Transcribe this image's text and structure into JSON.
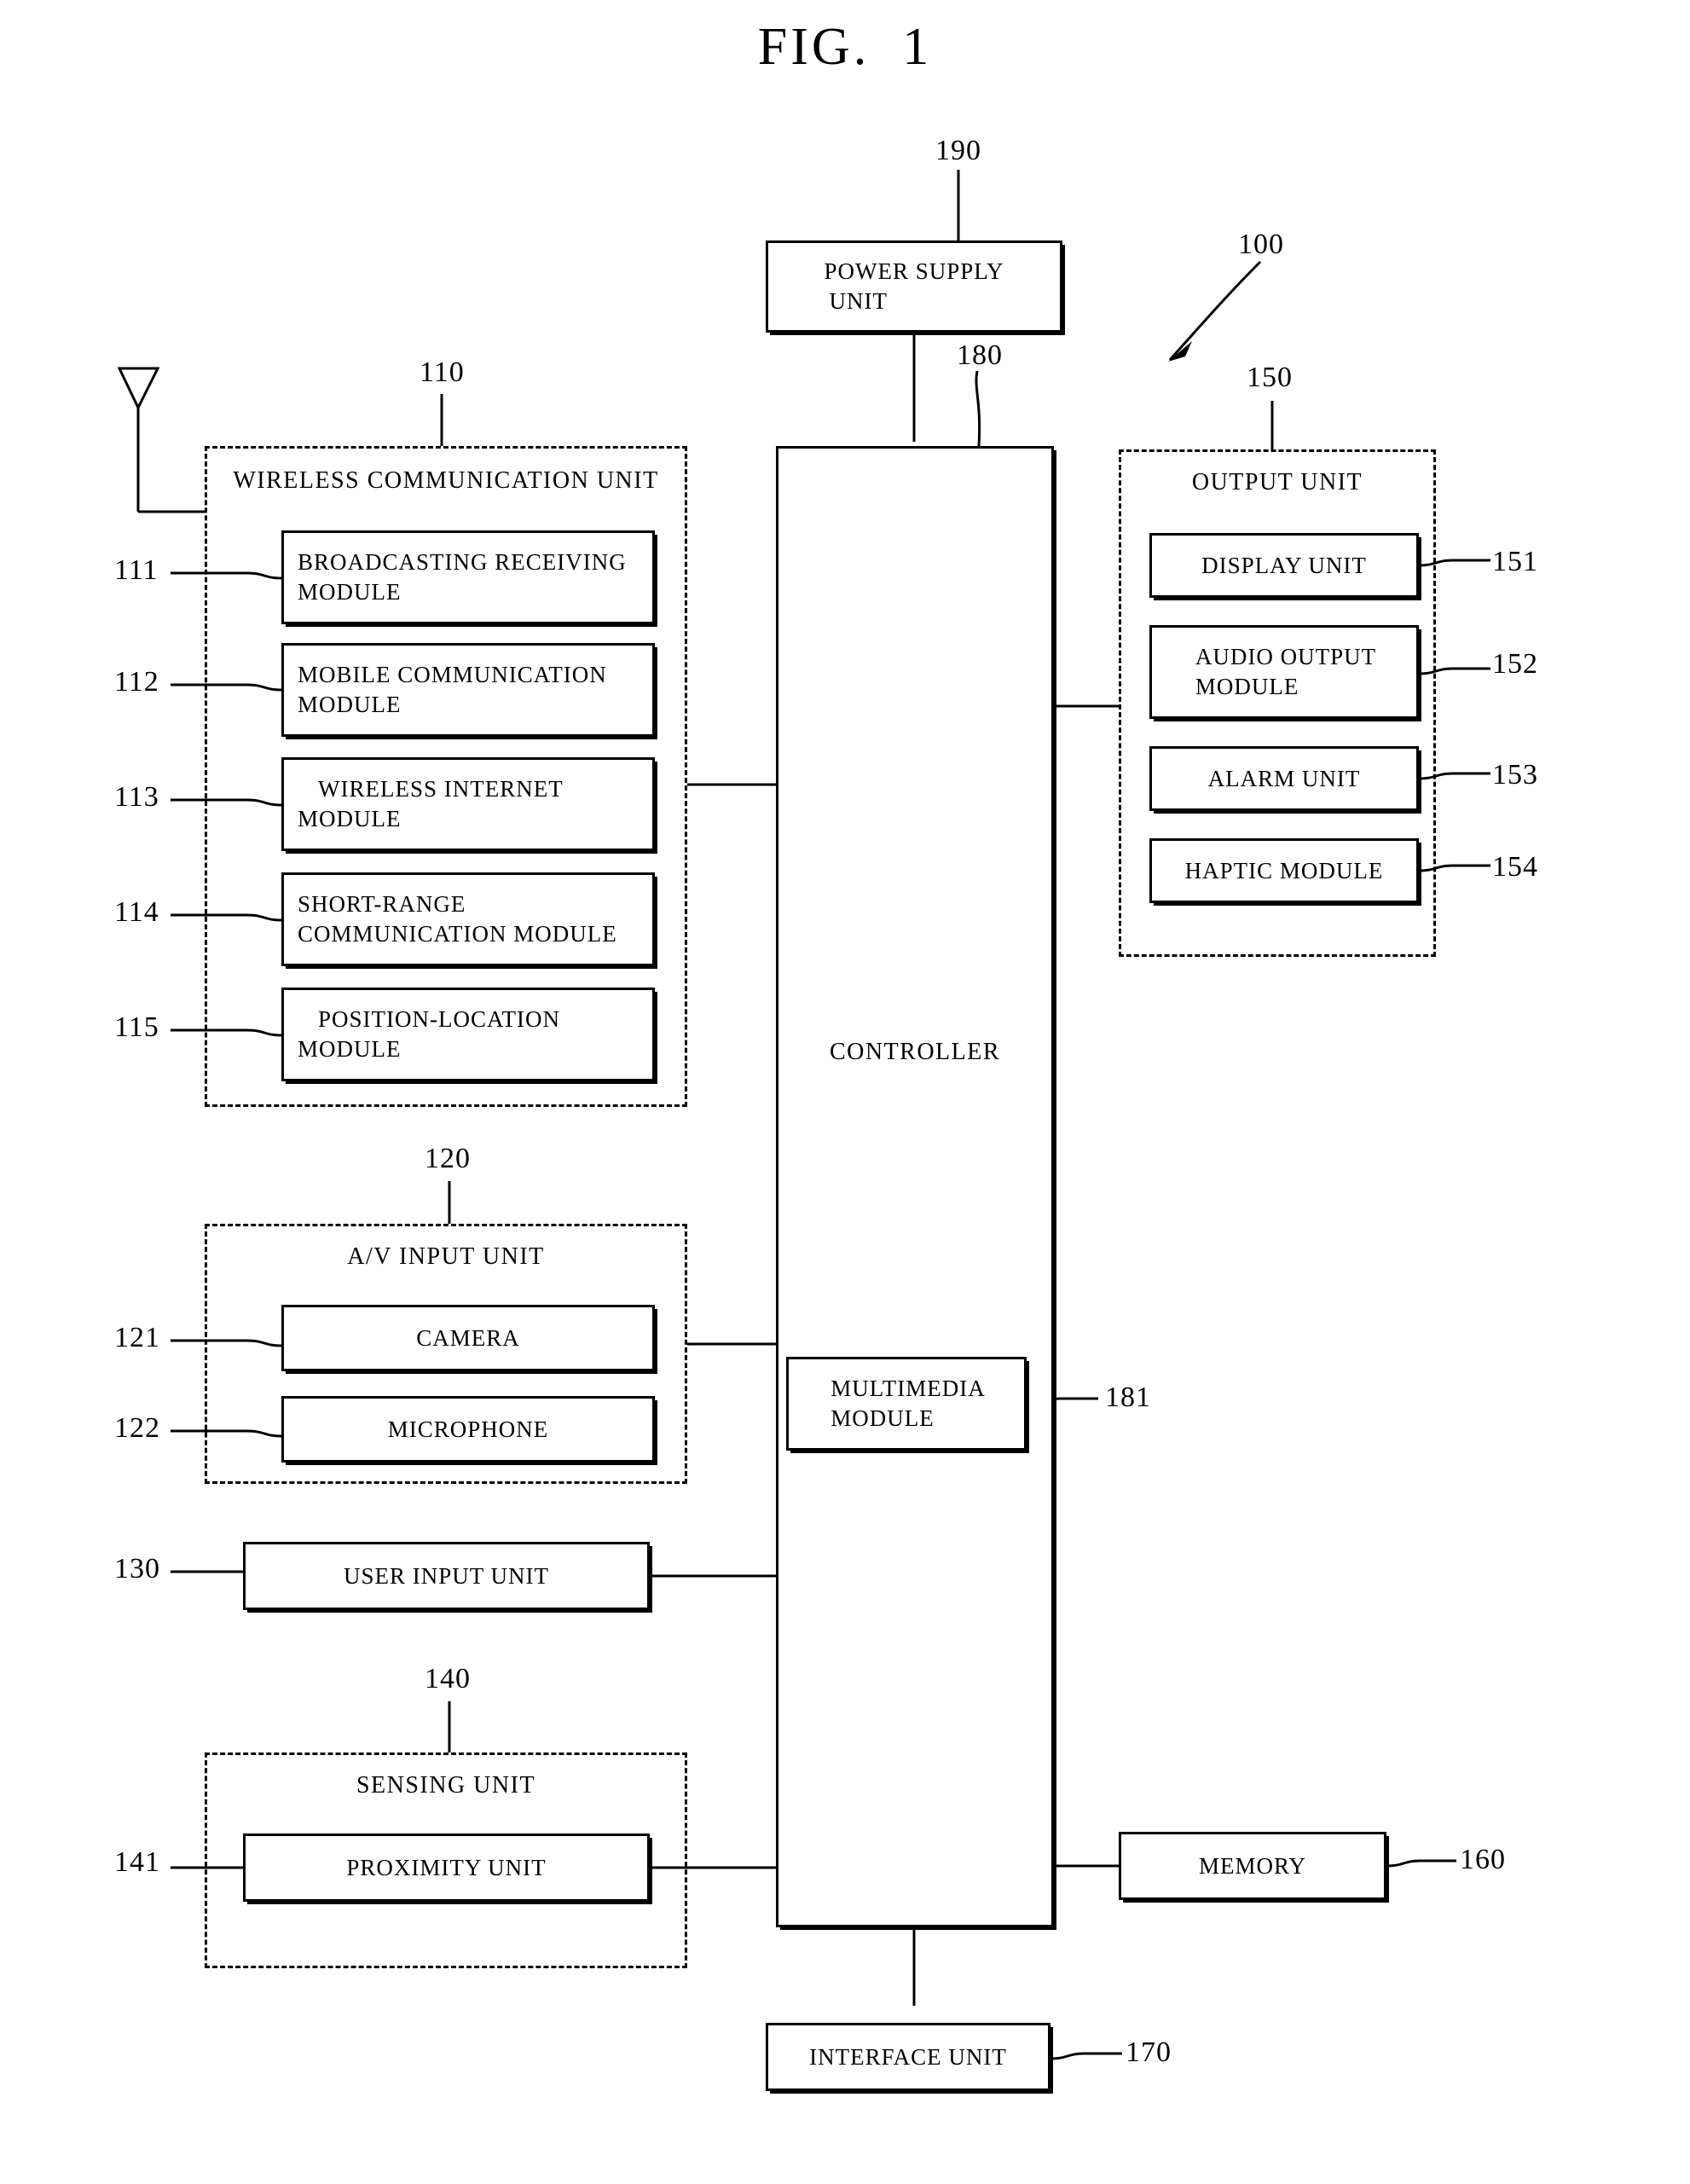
{
  "figure": {
    "label": "FIG.",
    "number": "1"
  },
  "refs": {
    "device": "100",
    "wireless_unit": "110",
    "broadcasting": "111",
    "mobile_comm": "112",
    "wireless_internet": "113",
    "short_range": "114",
    "position_location": "115",
    "av_input_unit": "120",
    "camera": "121",
    "microphone": "122",
    "user_input_unit": "130",
    "sensing_unit": "140",
    "proximity_unit": "141",
    "output_unit": "150",
    "display_unit": "151",
    "audio_output": "152",
    "alarm_unit": "153",
    "haptic_module": "154",
    "memory": "160",
    "interface_unit": "170",
    "controller": "180",
    "multimedia_module": "181",
    "power_supply": "190"
  },
  "blocks": {
    "power_supply_unit": "POWER SUPPLY\nUNIT",
    "power_supply_line1": "POWER SUPPLY",
    "power_supply_line2": "UNIT",
    "controller": "CONTROLLER",
    "multimedia_line1": "MULTIMEDIA",
    "multimedia_line2": "MODULE",
    "memory": "MEMORY",
    "interface_unit": "INTERFACE UNIT",
    "user_input_unit": "USER INPUT UNIT"
  },
  "wireless": {
    "title": "WIRELESS COMMUNICATION UNIT",
    "modules": [
      {
        "line1": "BROADCASTING  RECEIVING",
        "line2": "MODULE",
        "ref": "111"
      },
      {
        "line1": "MOBILE COMMUNICATION",
        "line2": "MODULE",
        "ref": "112"
      },
      {
        "line1": "WIRELESS  INTERNET",
        "line2": "MODULE",
        "ref": "113"
      },
      {
        "line1": "SHORT-RANGE",
        "line2": "COMMUNICATION MODULE",
        "ref": "114"
      },
      {
        "line1": "POSITION-LOCATION",
        "line2": "MODULE",
        "ref": "115"
      }
    ]
  },
  "av_input": {
    "title": "A/V INPUT UNIT",
    "items": [
      {
        "label": "CAMERA",
        "ref": "121"
      },
      {
        "label": "MICROPHONE",
        "ref": "122"
      }
    ]
  },
  "sensing": {
    "title": "SENSING UNIT",
    "items": [
      {
        "label": "PROXIMITY UNIT",
        "ref": "141"
      }
    ]
  },
  "output": {
    "title": "OUTPUT UNIT",
    "items": [
      {
        "line1": "DISPLAY UNIT",
        "line2": "",
        "ref": "151"
      },
      {
        "line1": "AUDIO OUTPUT",
        "line2": "MODULE",
        "ref": "152"
      },
      {
        "line1": "ALARM UNIT",
        "line2": "",
        "ref": "153"
      },
      {
        "line1": "HAPTIC MODULE",
        "line2": "",
        "ref": "154"
      }
    ]
  },
  "colors": {
    "ink": "#000000",
    "paper": "#ffffff"
  }
}
